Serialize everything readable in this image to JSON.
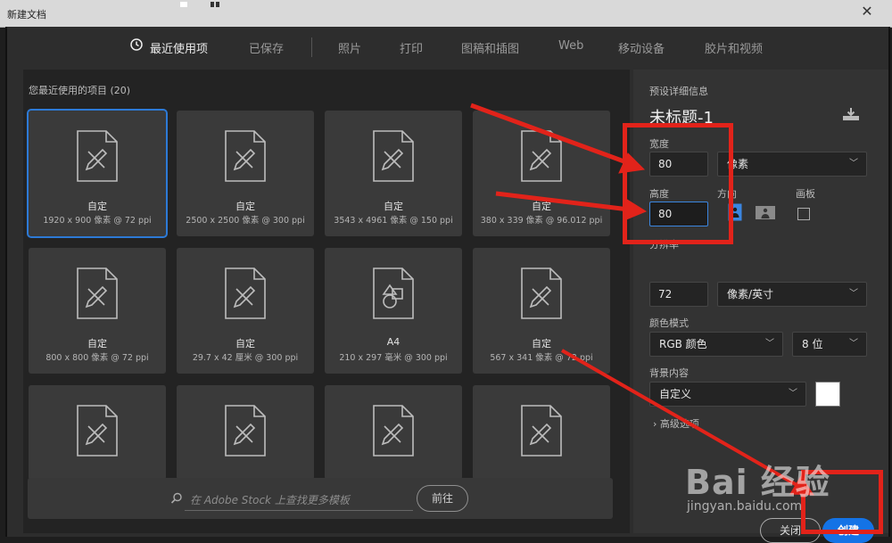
{
  "window": {
    "title": "新建文档",
    "close_glyph": "✕"
  },
  "tabs": [
    {
      "label": "最近使用项",
      "active": true
    },
    {
      "label": "已保存"
    },
    {
      "label": "照片"
    },
    {
      "label": "打印"
    },
    {
      "label": "图稿和插图"
    },
    {
      "label": "Web"
    },
    {
      "label": "移动设备"
    },
    {
      "label": "胶片和视频"
    }
  ],
  "recent": {
    "section_label": "您最近使用的项目",
    "count": "(20)",
    "items": [
      {
        "name": "自定",
        "dims": "1920 x 900 像素 @ 72 ppi",
        "icon": "document-pencil-icon"
      },
      {
        "name": "自定",
        "dims": "2500 x 2500 像素 @ 300 ppi",
        "icon": "document-pencil-icon"
      },
      {
        "name": "自定",
        "dims": "3543 x 4961 像素 @ 150 ppi",
        "icon": "document-pencil-icon"
      },
      {
        "name": "自定",
        "dims": "380 x 339 像素 @ 96.012 ppi",
        "icon": "document-pencil-icon"
      },
      {
        "name": "自定",
        "dims": "800 x 800 像素 @ 72 ppi",
        "icon": "document-pencil-icon"
      },
      {
        "name": "自定",
        "dims": "29.7 x 42 厘米 @ 300 ppi",
        "icon": "document-pencil-icon"
      },
      {
        "name": "A4",
        "dims": "210 x 297 毫米 @ 300 ppi",
        "icon": "document-shapes-icon"
      },
      {
        "name": "自定",
        "dims": "567 x 341 像素 @ 72 ppi",
        "icon": "document-pencil-icon"
      },
      {
        "name": "",
        "dims": "",
        "icon": "document-pencil-icon"
      },
      {
        "name": "",
        "dims": "",
        "icon": "document-pencil-icon"
      },
      {
        "name": "",
        "dims": "",
        "icon": "document-pencil-icon"
      },
      {
        "name": "",
        "dims": "",
        "icon": "document-pencil-icon"
      }
    ]
  },
  "stock": {
    "placeholder": "在 Adobe Stock 上查找更多模板",
    "go_label": "前往"
  },
  "preset": {
    "header": "预设详细信息",
    "doc_name": "未标题-1",
    "width_label": "宽度",
    "width_value": "80",
    "width_unit": "像素",
    "height_label": "高度",
    "height_value": "80",
    "orientation_label": "方向",
    "artboard_label": "画板",
    "resolution_label": "分辨率",
    "resolution_value": "72",
    "resolution_unit": "像素/英寸",
    "color_mode_label": "颜色模式",
    "color_mode_value": "RGB 颜色",
    "bit_depth_value": "8 位",
    "bg_label": "背景内容",
    "bg_value": "自定义",
    "bg_color": "#ffffff",
    "advanced_label": "高级选项"
  },
  "actions": {
    "close_label": "关闭",
    "create_label": "创建"
  },
  "watermark": {
    "brand": "Bai 经验",
    "url": "jingyan.baidu.com"
  },
  "colors": {
    "accent": "#1473e6",
    "selection": "#2d7ad6",
    "annotation_red": "#e2231a"
  }
}
